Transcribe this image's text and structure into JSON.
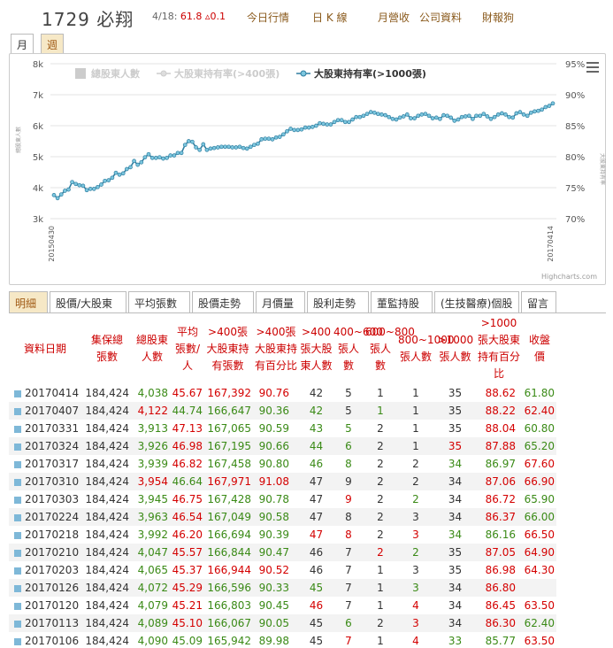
{
  "header": {
    "stock": "1729 必翔",
    "quote_date": "4/18:",
    "quote_price": "61.8",
    "quote_change": "▵0.1",
    "nav": [
      "今日行情",
      "日 K 線",
      "月營收",
      "公司資料",
      "財報狗"
    ]
  },
  "period_tabs": [
    "月",
    "週"
  ],
  "chart_data": {
    "type": "line",
    "title": "",
    "legend": [
      "總股東人數",
      "大股東持有率(>400張)",
      "大股東持有率(>1000張)"
    ],
    "visible_series": "大股東持有率(>1000張)",
    "y_left_ticks": [
      "3k",
      "4k",
      "5k",
      "6k",
      "7k",
      "8k"
    ],
    "y_left_label": "總股東人數",
    "y_right_ticks": [
      "70%",
      "75%",
      "80%",
      "85%",
      "90%",
      "95%"
    ],
    "y_right_label": "大股東持有率",
    "ylim_right": [
      70,
      95
    ],
    "x_range": [
      "20150430",
      "20170414"
    ],
    "credit": "Highcharts.com",
    "series": [
      {
        "name": "大股東持有率(>1000張)",
        "values": [
          73.8,
          73.3,
          73.9,
          74.5,
          74.7,
          75.9,
          75.6,
          75.4,
          75.3,
          74.6,
          74.8,
          74.8,
          75.1,
          75.5,
          76.1,
          76.2,
          76.6,
          77.4,
          77.1,
          77.3,
          78.0,
          78.3,
          79.3,
          78.7,
          79.1,
          79.9,
          80.4,
          79.8,
          79.8,
          79.9,
          79.7,
          79.8,
          80.2,
          80.2,
          80.6,
          80.6,
          81.9,
          82.5,
          82.4,
          81.5,
          81.1,
          82.0,
          81.1,
          81.3,
          81.4,
          81.5,
          81.6,
          81.6,
          81.6,
          81.5,
          81.5,
          81.6,
          81.4,
          81.3,
          81.6,
          81.9,
          82.1,
          82.8,
          82.9,
          82.9,
          82.8,
          83.1,
          83.2,
          83.6,
          84.1,
          84.5,
          84.3,
          84.3,
          84.4,
          84.7,
          84.7,
          84.8,
          85.0,
          85.4,
          85.3,
          85.2,
          85.2,
          85.6,
          85.9,
          85.9,
          85.6,
          85.6,
          86.0,
          86.4,
          86.4,
          86.6,
          86.9,
          87.2,
          87.1,
          86.9,
          86.8,
          86.7,
          86.4,
          86.1,
          86.0,
          86.3,
          86.5,
          86.8,
          86.2,
          86.2,
          86.6,
          86.8,
          86.9,
          86.6,
          86.2,
          86.3,
          86.1,
          86.7,
          86.6,
          86.3,
          85.8,
          86.0,
          86.4,
          86.5,
          86.6,
          86.1,
          86.6,
          86.6,
          86.9,
          86.5,
          86.1,
          86.4,
          86.8,
          87.0,
          86.8,
          86.4,
          86.3,
          87.0,
          87.2,
          86.8,
          86.6,
          87.1,
          87.3,
          87.4,
          87.6,
          88.0,
          88.2,
          88.6
        ]
      }
    ]
  },
  "detail_tabs": [
    "明細",
    "股價/大股東",
    "平均張數",
    "股價走勢",
    "月價量",
    "股利走勢",
    "董監持股",
    "(生技醫療)個股",
    "留言"
  ],
  "table": {
    "headers": [
      "資料日期",
      "集保總張數",
      "總股東人數",
      "平均張數/人",
      ">400張大股東持有張數",
      ">400張大股東持有百分比",
      ">400張大股東人數",
      "400~600張人數",
      "600~800張人數",
      "800~1000張人數",
      ">1000張人數",
      ">1000張大股東持有百分比",
      "收盤價"
    ],
    "rows": [
      [
        "20170414",
        "184,424",
        "4,038",
        "45.67",
        "167,392",
        "90.76",
        "42",
        "5",
        "1",
        "1",
        "35",
        "88.62",
        "61.80"
      ],
      [
        "20170407",
        "184,424",
        "4,122",
        "44.74",
        "166,647",
        "90.36",
        "42",
        "5",
        "1",
        "1",
        "35",
        "88.22",
        "62.40"
      ],
      [
        "20170331",
        "184,424",
        "3,913",
        "47.13",
        "167,065",
        "90.59",
        "43",
        "5",
        "2",
        "1",
        "35",
        "88.04",
        "60.80"
      ],
      [
        "20170324",
        "184,424",
        "3,926",
        "46.98",
        "167,195",
        "90.66",
        "44",
        "6",
        "2",
        "1",
        "35",
        "87.88",
        "65.20"
      ],
      [
        "20170317",
        "184,424",
        "3,939",
        "46.82",
        "167,458",
        "90.80",
        "46",
        "8",
        "2",
        "2",
        "34",
        "86.97",
        "67.60"
      ],
      [
        "20170310",
        "184,424",
        "3,954",
        "46.64",
        "167,971",
        "91.08",
        "47",
        "9",
        "2",
        "2",
        "34",
        "87.06",
        "66.90"
      ],
      [
        "20170303",
        "184,424",
        "3,945",
        "46.75",
        "167,428",
        "90.78",
        "47",
        "9",
        "2",
        "2",
        "34",
        "86.72",
        "65.90"
      ],
      [
        "20170224",
        "184,424",
        "3,963",
        "46.54",
        "167,049",
        "90.58",
        "47",
        "8",
        "2",
        "3",
        "34",
        "86.37",
        "66.00"
      ],
      [
        "20170218",
        "184,424",
        "3,992",
        "46.20",
        "166,694",
        "90.39",
        "47",
        "8",
        "2",
        "3",
        "34",
        "86.16",
        "66.50"
      ],
      [
        "20170210",
        "184,424",
        "4,047",
        "45.57",
        "166,844",
        "90.47",
        "46",
        "7",
        "2",
        "2",
        "35",
        "87.05",
        "64.90"
      ],
      [
        "20170203",
        "184,424",
        "4,065",
        "45.37",
        "166,944",
        "90.52",
        "46",
        "7",
        "1",
        "3",
        "35",
        "86.98",
        "64.30"
      ],
      [
        "20170126",
        "184,424",
        "4,072",
        "45.29",
        "166,596",
        "90.33",
        "45",
        "7",
        "1",
        "3",
        "34",
        "86.80",
        ""
      ],
      [
        "20170120",
        "184,424",
        "4,079",
        "45.21",
        "166,803",
        "90.45",
        "46",
        "7",
        "1",
        "4",
        "34",
        "86.45",
        "63.50"
      ],
      [
        "20170113",
        "184,424",
        "4,089",
        "45.10",
        "166,067",
        "90.05",
        "45",
        "6",
        "2",
        "3",
        "34",
        "86.30",
        "62.40"
      ],
      [
        "20170106",
        "184,424",
        "4,090",
        "45.09",
        "165,942",
        "89.98",
        "45",
        "7",
        "1",
        "4",
        "33",
        "85.77",
        "63.50"
      ]
    ],
    "colors": [
      [
        "k",
        "k",
        "g",
        "r",
        "r",
        "r",
        "k",
        "k",
        "k",
        "k",
        "k",
        "r",
        "g"
      ],
      [
        "k",
        "k",
        "r",
        "g",
        "g",
        "g",
        "g",
        "k",
        "g",
        "k",
        "k",
        "r",
        "r"
      ],
      [
        "k",
        "k",
        "g",
        "r",
        "g",
        "g",
        "g",
        "g",
        "k",
        "k",
        "k",
        "r",
        "g"
      ],
      [
        "k",
        "k",
        "g",
        "r",
        "g",
        "g",
        "g",
        "g",
        "k",
        "k",
        "r",
        "r",
        "g"
      ],
      [
        "k",
        "k",
        "g",
        "r",
        "g",
        "g",
        "g",
        "g",
        "k",
        "k",
        "g",
        "g",
        "r"
      ],
      [
        "k",
        "k",
        "r",
        "g",
        "r",
        "r",
        "k",
        "k",
        "k",
        "k",
        "k",
        "r",
        "r"
      ],
      [
        "k",
        "k",
        "g",
        "r",
        "g",
        "g",
        "k",
        "r",
        "k",
        "g",
        "k",
        "r",
        "g"
      ],
      [
        "k",
        "k",
        "g",
        "r",
        "g",
        "g",
        "k",
        "k",
        "k",
        "k",
        "k",
        "r",
        "g"
      ],
      [
        "k",
        "k",
        "g",
        "r",
        "g",
        "g",
        "r",
        "r",
        "k",
        "r",
        "g",
        "g",
        "r"
      ],
      [
        "k",
        "k",
        "g",
        "r",
        "g",
        "g",
        "k",
        "k",
        "r",
        "g",
        "k",
        "r",
        "r"
      ],
      [
        "k",
        "k",
        "g",
        "r",
        "r",
        "r",
        "k",
        "k",
        "k",
        "k",
        "k",
        "r",
        "r"
      ],
      [
        "k",
        "k",
        "g",
        "r",
        "g",
        "g",
        "g",
        "k",
        "k",
        "g",
        "k",
        "r",
        "k"
      ],
      [
        "k",
        "k",
        "g",
        "r",
        "g",
        "g",
        "r",
        "k",
        "k",
        "r",
        "k",
        "r",
        "r"
      ],
      [
        "k",
        "k",
        "g",
        "r",
        "g",
        "g",
        "k",
        "g",
        "k",
        "r",
        "k",
        "r",
        "g"
      ],
      [
        "k",
        "k",
        "g",
        "g",
        "g",
        "g",
        "k",
        "r",
        "k",
        "r",
        "g",
        "g",
        "r"
      ]
    ]
  }
}
